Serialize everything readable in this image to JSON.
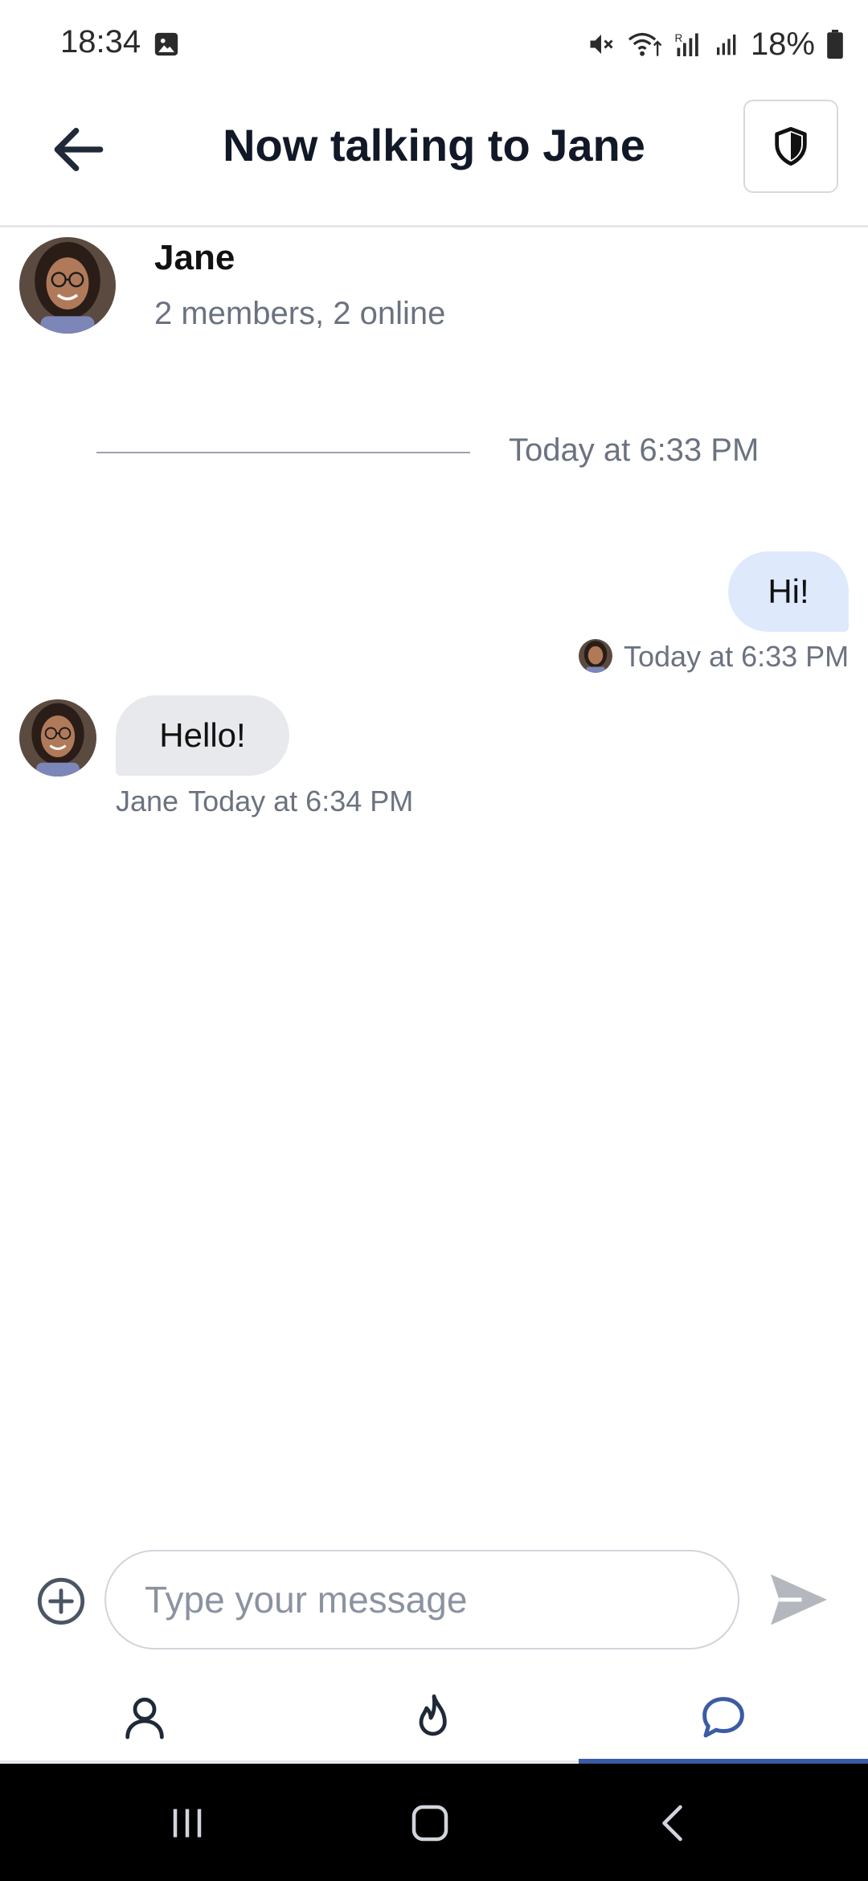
{
  "status_bar": {
    "time": "18:34",
    "battery": "18%",
    "icons": [
      "image-icon",
      "mute-icon",
      "wifi-icon",
      "signal-icon",
      "signal-icon",
      "battery-icon"
    ]
  },
  "header": {
    "title": "Now talking to Jane",
    "back_icon": "arrow-left-icon",
    "action_icon": "shield-icon"
  },
  "channel": {
    "name": "Jane",
    "subtitle": "2 members, 2 online"
  },
  "date_separator": "Today at 6:33 PM",
  "messages": [
    {
      "direction": "outgoing",
      "text": "Hi!",
      "timestamp": "Today at 6:33 PM"
    },
    {
      "direction": "incoming",
      "author": "Jane",
      "text": "Hello!",
      "timestamp": "Today at 6:34 PM"
    }
  ],
  "composer": {
    "placeholder": "Type your message",
    "add_icon": "plus-circle-icon",
    "send_icon": "send-icon"
  },
  "bottom_nav": {
    "items": [
      {
        "icon": "user-icon",
        "active": false
      },
      {
        "icon": "flame-icon",
        "active": false
      },
      {
        "icon": "chat-icon",
        "active": true
      }
    ],
    "active_color": "#3b5ba5"
  },
  "colors": {
    "outgoing_bubble": "#deeafb",
    "incoming_bubble": "#e8e9ec",
    "muted_text": "#6b7280"
  }
}
